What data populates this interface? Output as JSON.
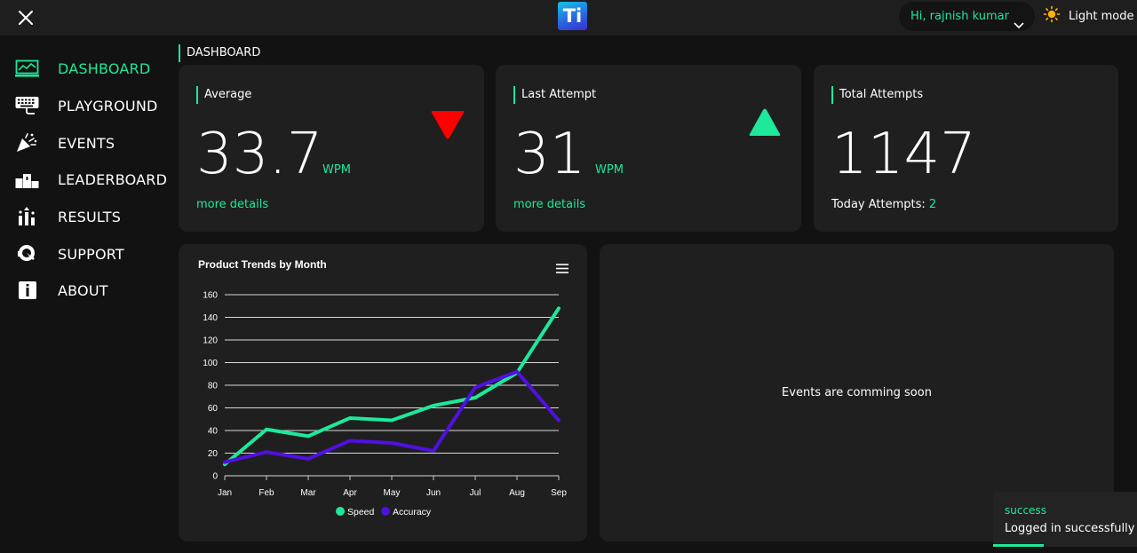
{
  "header": {
    "logo_text": "Ti",
    "greeting": "Hi, rajnish kumar",
    "mode_label": "Light mode"
  },
  "sidebar": {
    "items": [
      {
        "label": "DASHBOARD",
        "icon": "chart-monitor-icon",
        "active": true
      },
      {
        "label": "PLAYGROUND",
        "icon": "keyboard-icon",
        "active": false
      },
      {
        "label": "EVENTS",
        "icon": "party-popper-icon",
        "active": false
      },
      {
        "label": "LEADERBOARD",
        "icon": "podium-icon",
        "active": false
      },
      {
        "label": "RESULTS",
        "icon": "bar-results-icon",
        "active": false
      },
      {
        "label": "SUPPORT",
        "icon": "support-headset-icon",
        "active": false
      },
      {
        "label": "ABOUT",
        "icon": "info-icon",
        "active": false
      }
    ]
  },
  "main": {
    "section_title": "DASHBOARD",
    "cards": {
      "average": {
        "title": "Average",
        "value": "33.7",
        "unit": "WPM",
        "link": "more details",
        "trend": "down"
      },
      "last": {
        "title": "Last Attempt",
        "value": "31",
        "unit": "WPM",
        "link": "more details",
        "trend": "up"
      },
      "total": {
        "title": "Total Attempts",
        "value": "1147",
        "today_label": "Today Attempts:",
        "today_value": "2"
      }
    },
    "events_message": "Events are comming soon"
  },
  "colors": {
    "accent": "#1ee89a",
    "down": "#ff0000",
    "speed": "#1ee89a",
    "accuracy": "#5010e0"
  },
  "chart_data": {
    "type": "line",
    "title": "Product Trends by Month",
    "categories": [
      "Jan",
      "Feb",
      "Mar",
      "Apr",
      "May",
      "Jun",
      "Jul",
      "Aug",
      "Sep"
    ],
    "series": [
      {
        "name": "Speed",
        "values": [
          10,
          41,
          35,
          51,
          49,
          62,
          69,
          91,
          148
        ]
      },
      {
        "name": "Accuracy",
        "values": [
          12,
          21,
          15,
          31,
          29,
          22,
          78,
          92,
          49
        ]
      }
    ],
    "yticks": [
      0,
      20,
      40,
      60,
      80,
      100,
      120,
      140,
      160
    ],
    "ylim": [
      0,
      160
    ],
    "grid": true,
    "legend": "bottom-center"
  },
  "toast": {
    "title": "success",
    "message": "Logged in successfully"
  }
}
